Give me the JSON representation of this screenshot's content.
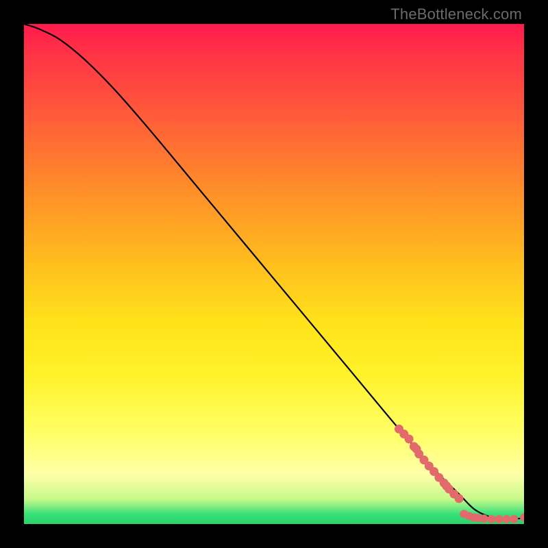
{
  "watermark": "TheBottleneck.com",
  "chart_data": {
    "type": "line",
    "title": "",
    "xlabel": "",
    "ylabel": "",
    "xlim": [
      0,
      100
    ],
    "ylim": [
      0,
      100
    ],
    "grid": false,
    "series": [
      {
        "name": "curve",
        "kind": "line",
        "color": "#000000",
        "x": [
          0,
          3,
          7,
          12,
          18,
          25,
          35,
          45,
          55,
          65,
          75,
          82,
          87,
          90,
          93,
          96,
          98,
          100
        ],
        "y": [
          100,
          99,
          97,
          93,
          87,
          79,
          67,
          55,
          43,
          31,
          19,
          11,
          6,
          3,
          1.5,
          1.0,
          1.0,
          1.2
        ]
      },
      {
        "name": "dots-upper",
        "kind": "scatter",
        "color": "#e26a6a",
        "x": [
          75,
          76,
          77,
          78,
          78.5,
          79,
          80,
          81,
          82,
          83,
          84,
          84.5,
          85,
          86,
          87
        ],
        "y": [
          19,
          18,
          17,
          15.5,
          15,
          14,
          12.8,
          11.6,
          10.5,
          9.3,
          8.2,
          7.6,
          7.0,
          6.0,
          5.1
        ]
      },
      {
        "name": "dots-lower",
        "kind": "scatter",
        "color": "#e26a6a",
        "x": [
          88,
          89,
          90,
          90.8,
          92,
          93.5,
          95,
          96.5,
          98,
          100
        ],
        "y": [
          2.0,
          1.6,
          1.3,
          1.2,
          1.1,
          1.0,
          1.0,
          1.0,
          1.0,
          1.3
        ]
      }
    ]
  }
}
